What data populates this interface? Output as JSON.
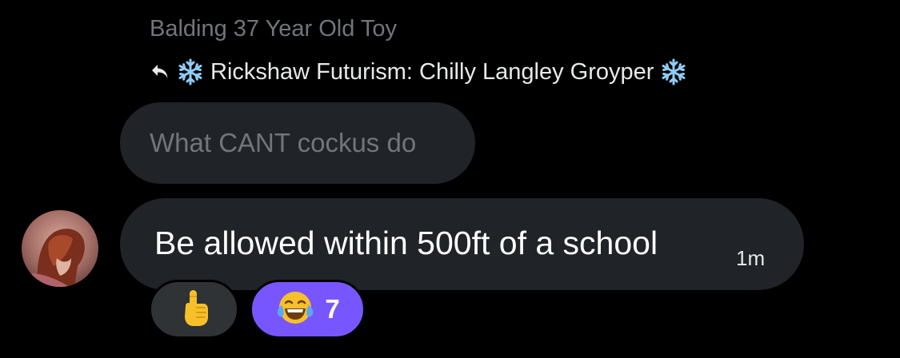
{
  "reply": {
    "sender_name": "Balding 37 Year Old Toy",
    "replying_to": "Rickshaw Futurism: Chilly Langley Groyper",
    "quoted_text": "What CANT cockus do",
    "icons": [
      "reply-arrow-icon",
      "snowflake-icon"
    ]
  },
  "message": {
    "text": "Be allowed within 500ft of a school",
    "timestamp": "1m"
  },
  "reactions": [
    {
      "emoji_name": "pointing-up-icon",
      "count": ""
    },
    {
      "emoji_name": "tears-of-joy-icon",
      "count": "7"
    }
  ],
  "colors": {
    "background": "#000000",
    "bubble": "#202327",
    "muted_text": "#71767b",
    "reaction_active": "#7856ff",
    "reaction_inactive": "#2f3336"
  }
}
